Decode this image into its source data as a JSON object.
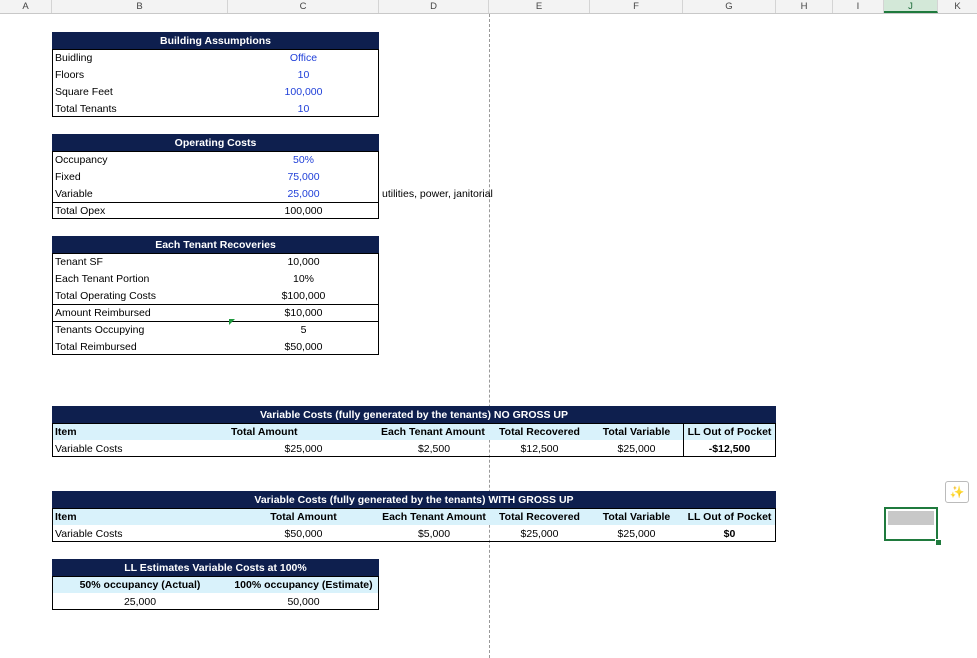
{
  "columns": [
    "A",
    "B",
    "C",
    "D",
    "E",
    "F",
    "G",
    "H",
    "I",
    "J",
    "K"
  ],
  "building": {
    "header": "Building Assumptions",
    "rows": [
      {
        "label": "Buidling",
        "value": "Office"
      },
      {
        "label": "Floors",
        "value": "10"
      },
      {
        "label": "Square Feet",
        "value": "100,000"
      },
      {
        "label": "Total Tenants",
        "value": "10"
      }
    ]
  },
  "operating": {
    "header": "Operating Costs",
    "rows": [
      {
        "label": "Occupancy",
        "value": "50%"
      },
      {
        "label": "Fixed",
        "value": "75,000"
      },
      {
        "label": "Variable",
        "value": "25,000"
      },
      {
        "label": "Total Opex",
        "value": "100,000"
      }
    ],
    "note": "utilities, power, janitorial"
  },
  "recoveries": {
    "header": "Each Tenant Recoveries",
    "rows": [
      {
        "label": "Tenant SF",
        "value": "10,000"
      },
      {
        "label": "Each Tenant Portion",
        "value": "10%"
      },
      {
        "label": "Total Operating Costs",
        "value": "$100,000"
      },
      {
        "label": "Amount Reimbursed",
        "value": "$10,000"
      },
      {
        "label": "Tenants Occupying",
        "value": "5"
      },
      {
        "label": "Total Reimbursed",
        "value": "$50,000"
      }
    ]
  },
  "no_gross_up": {
    "header": "Variable Costs (fully generated by the tenants) NO GROSS UP",
    "cols": [
      "Item",
      "Total Amount",
      "Each Tenant Amount",
      "Total Recovered",
      "Total Variable",
      "LL Out of Pocket"
    ],
    "row": [
      "Variable Costs",
      "$25,000",
      "$2,500",
      "$12,500",
      "$25,000",
      "-$12,500"
    ]
  },
  "with_gross_up": {
    "header": "Variable Costs (fully generated by the tenants) WITH GROSS UP",
    "cols": [
      "Item",
      "Total Amount",
      "Each Tenant Amount",
      "Total Recovered",
      "Total Variable",
      "LL Out of Pocket"
    ],
    "row": [
      "Variable Costs",
      "$50,000",
      "$5,000",
      "$25,000",
      "$25,000",
      "$0"
    ]
  },
  "estimates": {
    "header": "LL Estimates Variable Costs at 100%",
    "cols": [
      "50% occupancy (Actual)",
      "100% occupancy (Estimate)"
    ],
    "row": [
      "25,000",
      "50,000"
    ]
  },
  "copilot_icon": "sparkle-icon"
}
